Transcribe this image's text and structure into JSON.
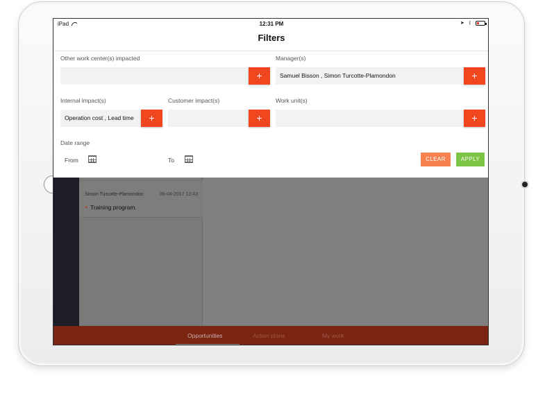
{
  "status_bar": {
    "device": "iPad",
    "time": "12:31 PM",
    "battery_color": "#e33333"
  },
  "header": {
    "title": "Filters"
  },
  "filters": {
    "other_work_centers": {
      "label": "Other work center(s) impacted",
      "value": ""
    },
    "managers": {
      "label": "Manager(s)",
      "value": "Samuel Bisson , Simon Turcotte-Plamondon"
    },
    "internal_impact": {
      "label": "Internal impact(s)",
      "value": "Operation cost , Lead time"
    },
    "customer_impact": {
      "label": "Customer impact(s)",
      "value": ""
    },
    "work_unit": {
      "label": "Work unit(s)",
      "value": ""
    },
    "add_symbol": "+",
    "date_range": {
      "label": "Date range",
      "from_label": "From",
      "to_label": "To"
    },
    "clear_label": "CLEAR",
    "apply_label": "APPLY"
  },
  "background_list": {
    "items": [
      {
        "author": "Simon Turcotte-Plamondon",
        "date": "06-04-2017 13:43",
        "text": "Training program."
      }
    ]
  },
  "tabs": [
    {
      "label": "Opportunities",
      "active": true
    },
    {
      "label": "Action plans",
      "active": false
    },
    {
      "label": "My work",
      "active": false
    }
  ],
  "colors": {
    "accent_add": "#f2461f",
    "clear": "#f7824f",
    "apply": "#7cc444",
    "tab_bar": "#7a2412"
  },
  "icons": {
    "wifi": "wifi-icon",
    "location": "location-arrow-icon",
    "bluetooth": "bluetooth-icon",
    "battery": "battery-icon",
    "calendar": "calendar-icon"
  }
}
